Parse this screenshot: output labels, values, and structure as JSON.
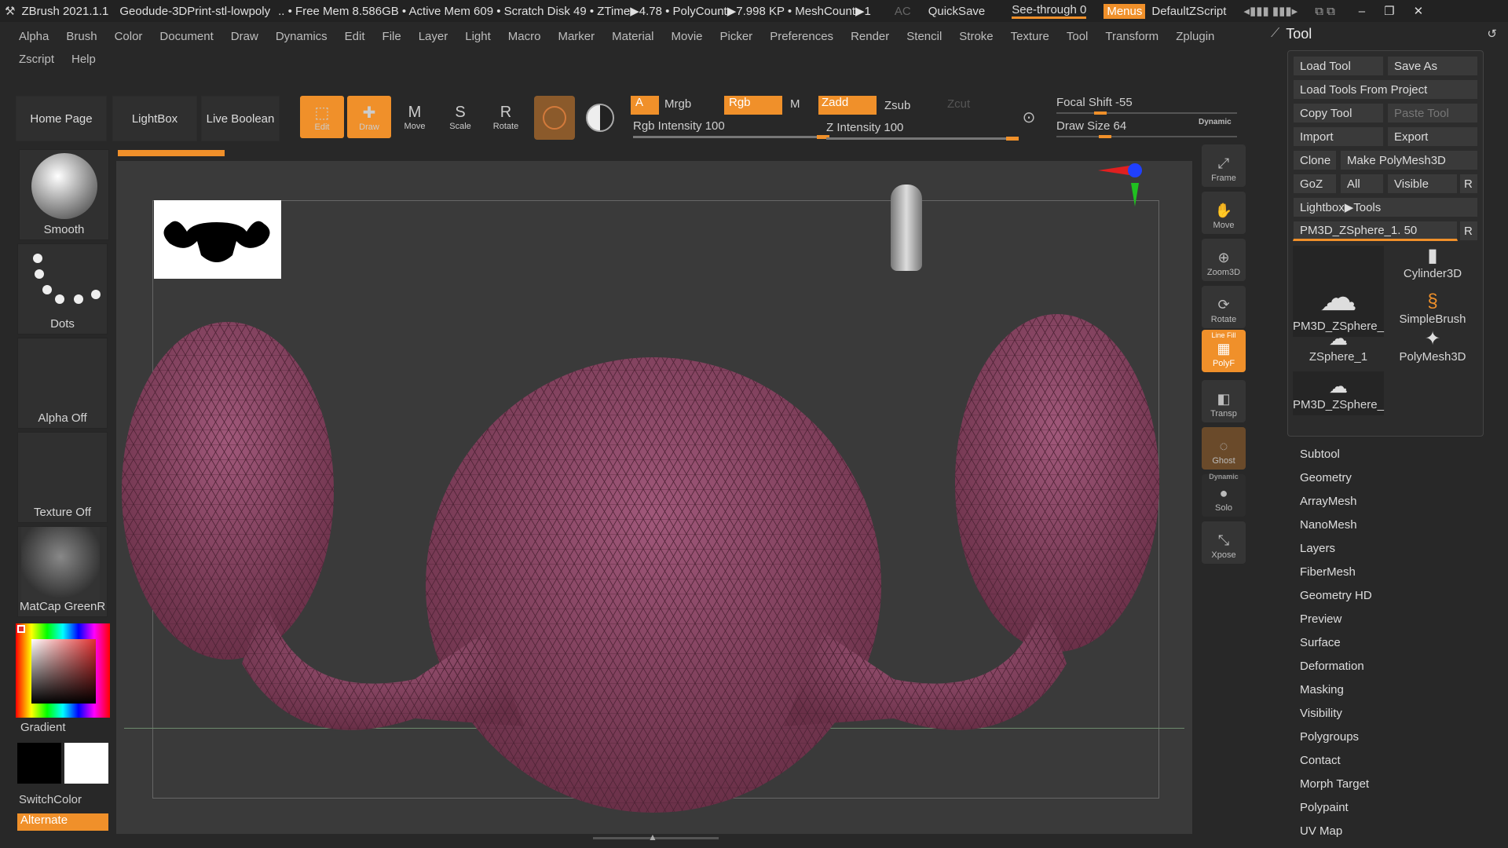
{
  "title_bar": {
    "app": "ZBrush 2021.1.1",
    "document": "Geodude-3DPrint-stl-lowpoly",
    "stats": ".. • Free Mem 8.586GB • Active Mem 609 • Scratch Disk 49 • ZTime▶4.78 • PolyCount▶7.998 KP • MeshCount▶1",
    "ac": "AC",
    "quicksave": "QuickSave",
    "see_through": "See-through  0",
    "menus": "Menus",
    "script": "DefaultZScript"
  },
  "menu_bar": [
    "Alpha",
    "Brush",
    "Color",
    "Document",
    "Draw",
    "Dynamics",
    "Edit",
    "File",
    "Layer",
    "Light",
    "Macro",
    "Marker",
    "Material",
    "Movie",
    "Picker",
    "Preferences",
    "Render",
    "Stencil",
    "Stroke",
    "Texture",
    "Tool",
    "Transform",
    "Zplugin"
  ],
  "menu_bar2": [
    "Zscript",
    "Help"
  ],
  "shelf": {
    "home": "Home Page",
    "lightbox": "LightBox",
    "live_boolean": "Live Boolean",
    "tools": [
      "Edit",
      "Draw",
      "Move",
      "Scale",
      "Rotate"
    ],
    "a": "A",
    "mrgb": "Mrgb",
    "rgb": "Rgb",
    "m": "M",
    "zadd": "Zadd",
    "zsub": "Zsub",
    "zcut": "Zcut",
    "rgb_intensity": "Rgb Intensity 100",
    "z_intensity": "Z Intensity 100",
    "focal_shift": "Focal Shift -55",
    "draw_size": "Draw Size 64",
    "dynamic": "Dynamic",
    "rgb_intensity_level": 1.0,
    "z_intensity_level": 1.0,
    "focal_shift_level": 0.225,
    "draw_size_level": 0.25
  },
  "left_tray": {
    "brush": "Smooth",
    "stroke": "Dots",
    "alpha": "Alpha Off",
    "texture": "Texture Off",
    "material": "MatCap GreenRo",
    "gradient": "Gradient",
    "switchcolor": "SwitchColor",
    "alternate": "Alternate"
  },
  "right_shelf": [
    "Frame",
    "Move",
    "Zoom3D",
    "Rotate",
    "PolyF",
    "Transp",
    "Ghost",
    "Solo",
    "Xpose"
  ],
  "right_shelf_extras": {
    "linefill": "Line Fill",
    "dynamic": "Dynamic"
  },
  "tool_panel": {
    "title": "Tool",
    "buttons": {
      "load_tool": "Load Tool",
      "save_as": "Save As",
      "load_from_project": "Load Tools From Project",
      "copy_tool": "Copy Tool",
      "paste_tool": "Paste Tool",
      "import": "Import",
      "export": "Export",
      "clone": "Clone",
      "make_polymesh": "Make PolyMesh3D",
      "goz": "GoZ",
      "all": "All",
      "visible": "Visible",
      "r": "R",
      "lightbox_tools": "Lightbox▶Tools",
      "current_tool": "PM3D_ZSphere_1. 50"
    },
    "thumbnails": [
      "PM3D_ZSphere_",
      "Cylinder3D",
      "SimpleBrush",
      "ZSphere_1",
      "PolyMesh3D",
      "PM3D_ZSphere_"
    ],
    "sections": [
      "Subtool",
      "Geometry",
      "ArrayMesh",
      "NanoMesh",
      "Layers",
      "FiberMesh",
      "Geometry HD",
      "Preview",
      "Surface",
      "Deformation",
      "Masking",
      "Visibility",
      "Polygroups",
      "Contact",
      "Morph Target",
      "Polypaint",
      "UV Map"
    ]
  },
  "colors": {
    "accent": "#f0902a",
    "mesh": "#8a4660"
  }
}
